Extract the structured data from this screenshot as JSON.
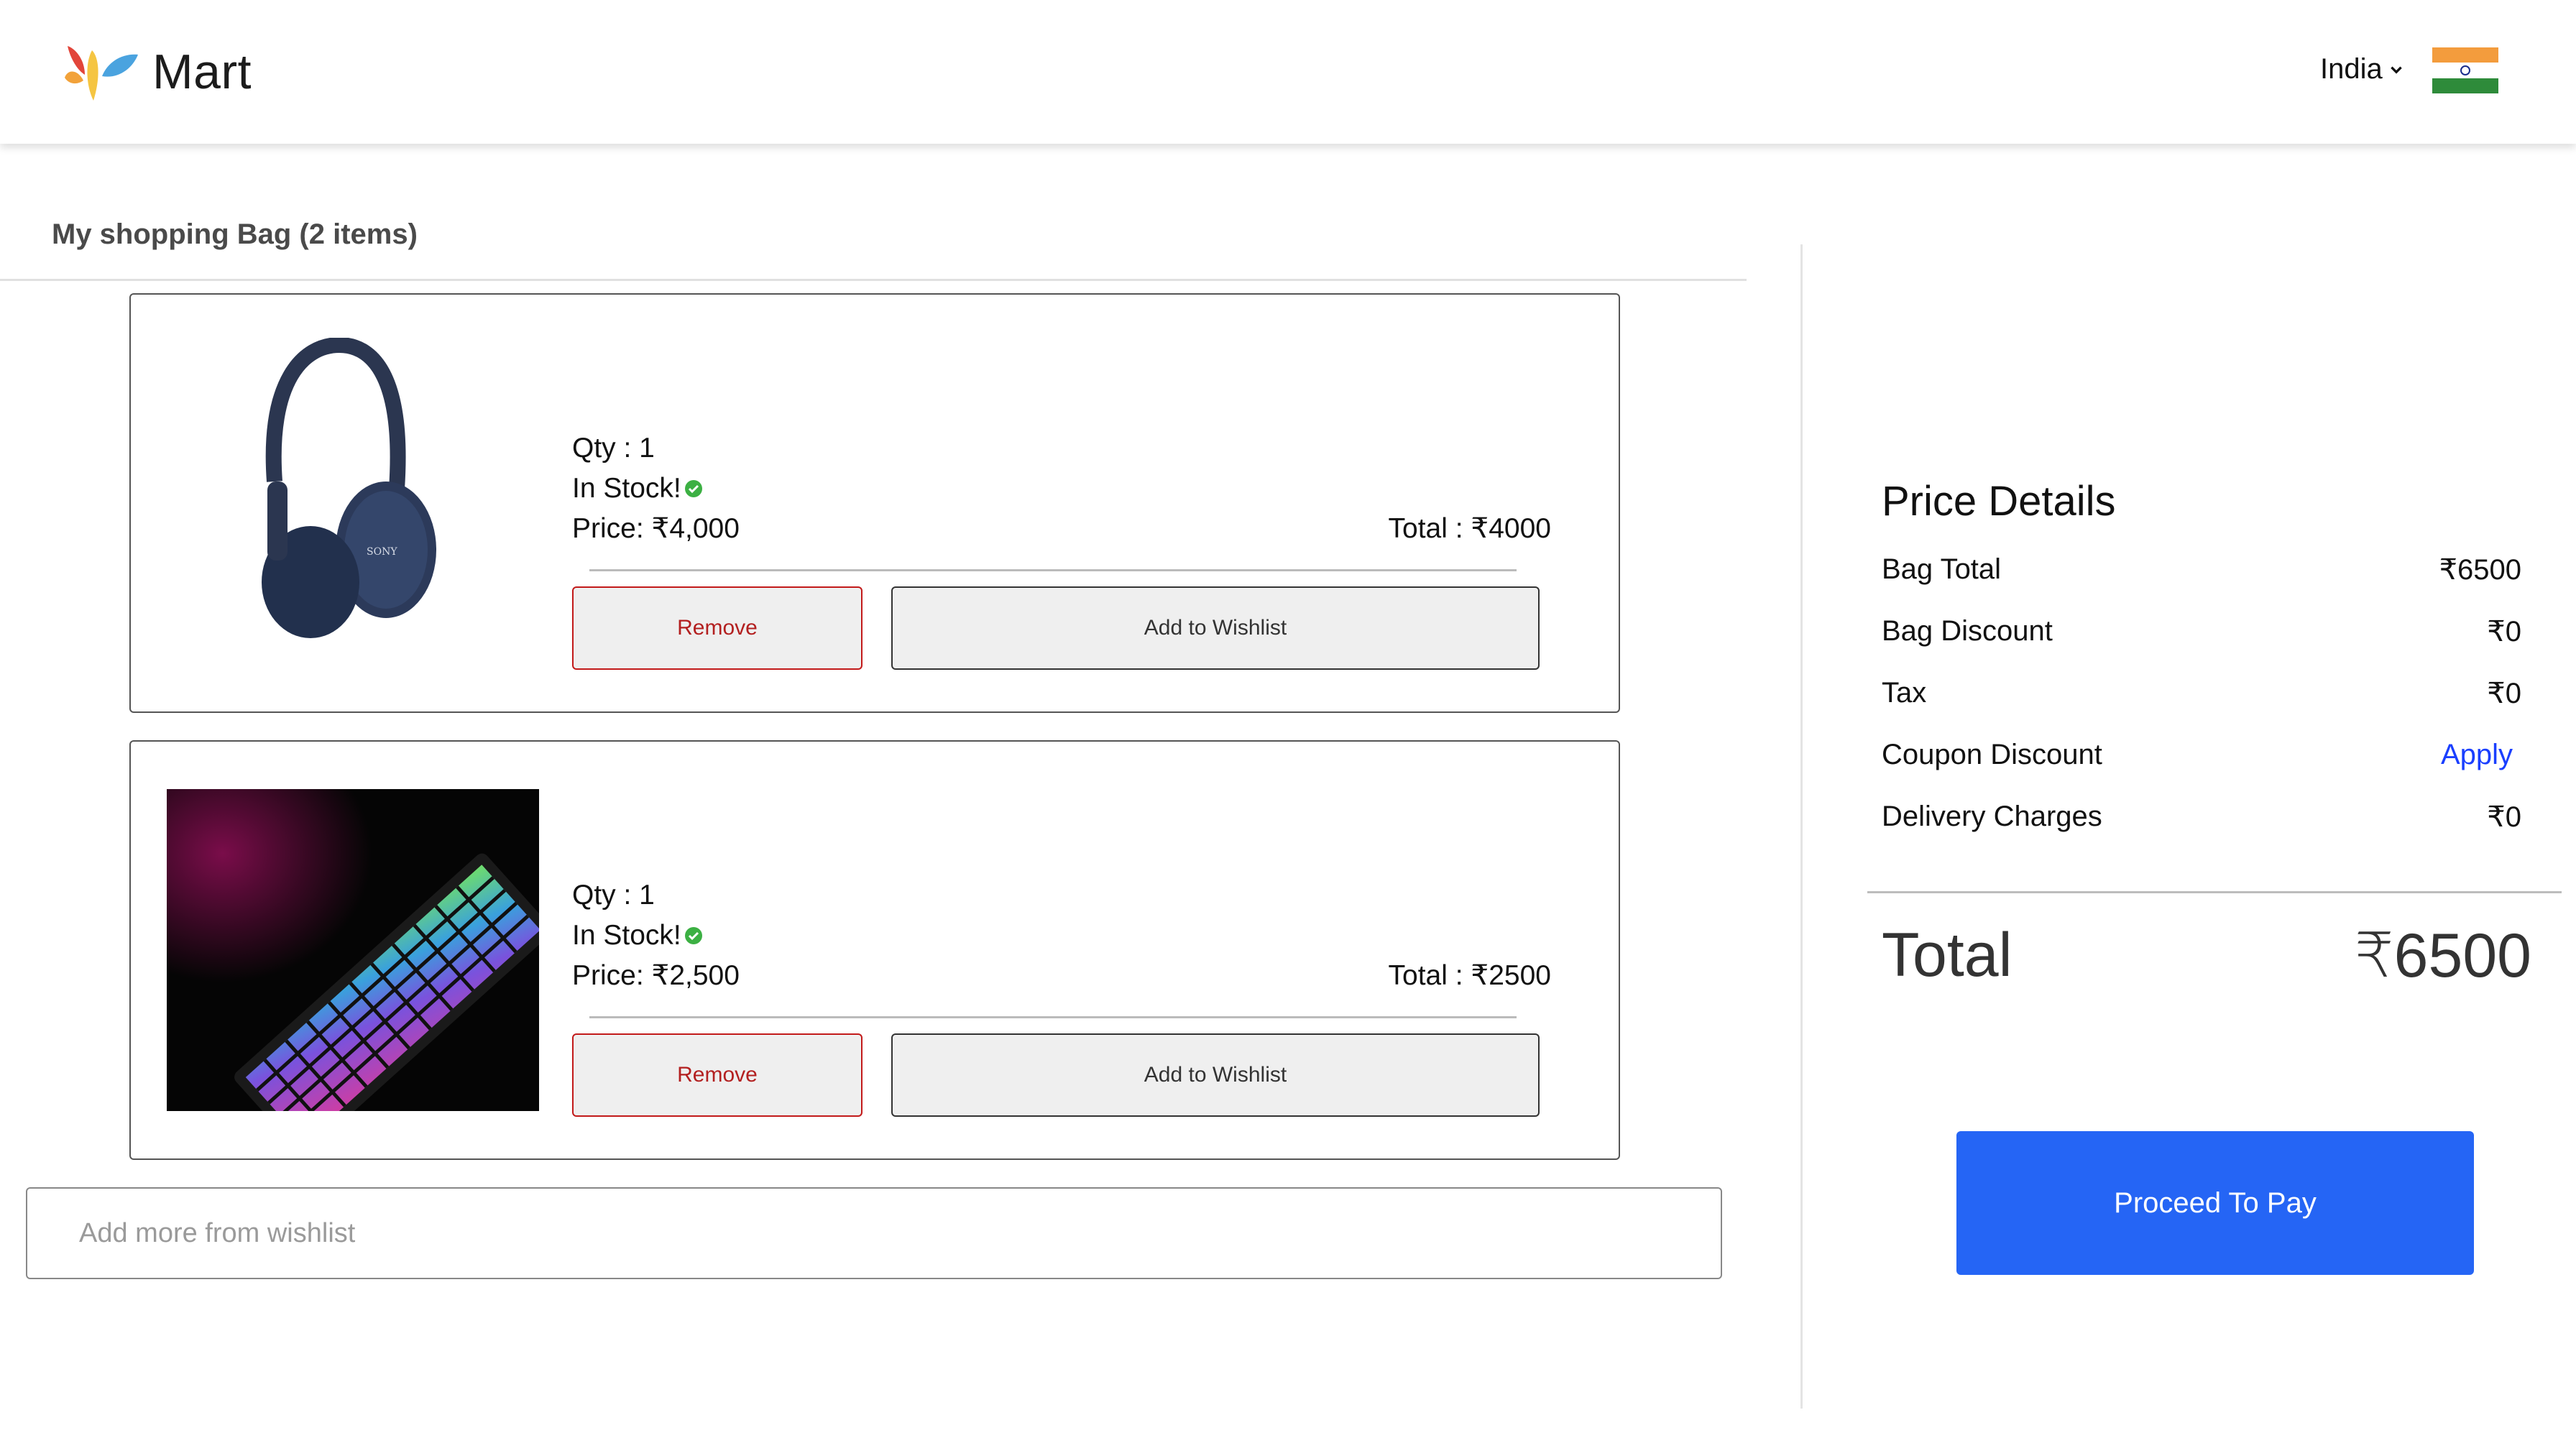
{
  "header": {
    "logo_text": "Mart",
    "country": "India",
    "flag_icon": "india-flag-icon"
  },
  "bag": {
    "title": "My shopping Bag (2 items)",
    "items": [
      {
        "image": "headphones-product-image",
        "image_brand_text": "SONY",
        "qty": "Qty : 1",
        "stock": "In Stock!",
        "price": "Price: ₹4,000",
        "total": "Total : ₹4000",
        "remove_label": "Remove",
        "wishlist_label": "Add to Wishlist"
      },
      {
        "image": "keyboard-product-image",
        "qty": "Qty : 1",
        "stock": "In Stock!",
        "price": "Price: ₹2,500",
        "total": "Total : ₹2500",
        "remove_label": "Remove",
        "wishlist_label": "Add to Wishlist"
      }
    ],
    "add_more_label": "Add more from wishlist"
  },
  "price_details": {
    "title": "Price Details",
    "rows": [
      {
        "label": "Bag Total",
        "value": "₹6500"
      },
      {
        "label": "Bag Discount",
        "value": "₹0"
      },
      {
        "label": "Tax",
        "value": "₹0"
      },
      {
        "label": "Coupon Discount",
        "value": "Apply"
      },
      {
        "label": "Delivery Charges",
        "value": "₹0"
      }
    ],
    "total_label": "Total",
    "total_value": "₹6500",
    "pay_label": "Proceed To Pay"
  },
  "colors": {
    "accent": "#2565f5",
    "remove": "#c21a1a",
    "in_stock": "#3cb043",
    "apply_link": "#1a3fff"
  }
}
